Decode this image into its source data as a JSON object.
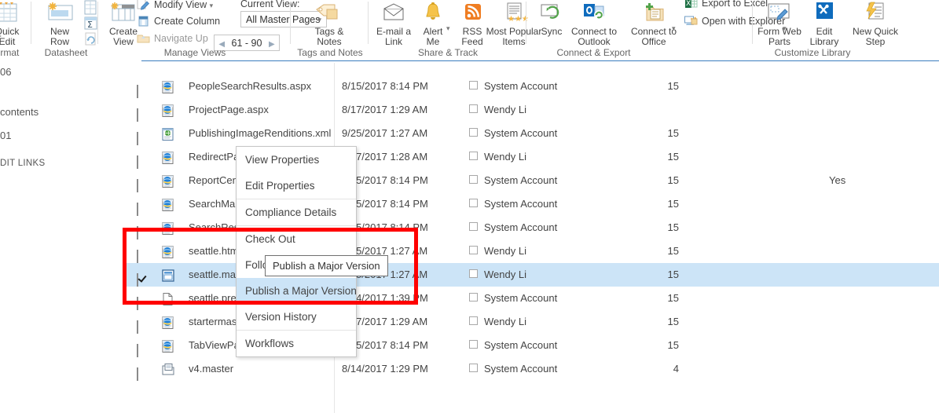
{
  "ribbon": {
    "groups": [
      {
        "name": "format",
        "label": "ormat"
      },
      {
        "name": "datasheet",
        "label": "Datasheet"
      },
      {
        "name": "manage-views",
        "label": "Manage Views"
      },
      {
        "name": "tags-and-notes",
        "label": "Tags and Notes"
      },
      {
        "name": "share-and-track",
        "label": "Share & Track"
      },
      {
        "name": "connect-and-export",
        "label": "Connect & Export"
      },
      {
        "name": "customize-library",
        "label": "Customize Library"
      }
    ],
    "buttons": {
      "quick_edit": "Quick\nEdit",
      "new_row": "New\nRow",
      "create_view": "Create\nView",
      "tags_notes": "Tags &\nNotes",
      "email_link": "E-mail a\nLink",
      "alert_me": "Alert\nMe",
      "rss_feed": "RSS\nFeed",
      "most_popular": "Most Popular\nItems",
      "sync": "Sync",
      "connect_outlook": "Connect to\nOutlook",
      "connect_office": "Connect to\nOffice",
      "form_web_parts": "Form Web\nParts",
      "edit_library": "Edit\nLibrary",
      "new_quick_step": "New Quick\nStep"
    },
    "small_commands": {
      "modify_view": "Modify View",
      "create_column": "Create Column",
      "navigate_up": "Navigate Up",
      "export_to_excel": "Export to Excel",
      "open_with_explorer": "Open with Explorer"
    },
    "current_view_label": "Current View:",
    "view_selector_value": "All Master Pages",
    "pager_value": "61 - 90"
  },
  "leftnav": {
    "fragments": [
      {
        "name": "nav-fragment-06",
        "text": "06"
      },
      {
        "name": "nav-fragment-contents",
        "text": "contents"
      },
      {
        "name": "nav-fragment-01",
        "text": "01"
      },
      {
        "name": "nav-fragment-edit-links",
        "text": "DIT LINKS"
      }
    ]
  },
  "list": {
    "rows": [
      {
        "name": "PeopleSearchResults.aspx",
        "icon": "aspx-page-icon",
        "date": "8/15/2017 8:14 PM",
        "modified_by": "System Account",
        "version": "15",
        "approved": "",
        "selected": false,
        "checked": false
      },
      {
        "name": "ProjectPage.aspx",
        "icon": "aspx-page-icon",
        "date": "8/17/2017 1:29 AM",
        "modified_by": "Wendy Li",
        "version": "",
        "approved": "",
        "selected": false,
        "checked": false
      },
      {
        "name": "PublishingImageRenditions.xml",
        "icon": "xml-file-icon",
        "date": "9/25/2017 1:27 AM",
        "modified_by": "System Account",
        "version": "15",
        "approved": "",
        "selected": false,
        "checked": false
      },
      {
        "name": "RedirectPageLayout.aspx",
        "icon": "aspx-page-icon",
        "date": "8/17/2017 1:28 AM",
        "modified_by": "Wendy Li",
        "version": "15",
        "approved": "",
        "selected": false,
        "checked": false
      },
      {
        "name": "ReportCenterLayout.aspx",
        "icon": "aspx-page-icon",
        "date": "8/15/2017 8:14 PM",
        "modified_by": "System Account",
        "version": "15",
        "approved": "Yes",
        "selected": false,
        "checked": false
      },
      {
        "name": "SearchMain.aspx",
        "icon": "aspx-page-icon",
        "date": "8/15/2017 8:14 PM",
        "modified_by": "System Account",
        "version": "15",
        "approved": "",
        "selected": false,
        "checked": false
      },
      {
        "name": "SearchResults.aspx",
        "icon": "aspx-page-icon",
        "date": "8/15/2017 8:14 PM",
        "modified_by": "System Account",
        "version": "15",
        "approved": "",
        "selected": false,
        "checked": false
      },
      {
        "name": "seattle.html",
        "icon": "aspx-page-icon",
        "date": "9/25/2017 1:27 AM",
        "modified_by": "Wendy Li",
        "version": "15",
        "approved": "",
        "selected": false,
        "checked": false
      },
      {
        "name": "seattle.master",
        "icon": "master-page-icon",
        "date": "9/25/2017 1:27 AM",
        "modified_by": "Wendy Li",
        "version": "15",
        "approved": "",
        "selected": true,
        "checked": true
      },
      {
        "name": "seattle.preview",
        "icon": "blank-file-icon",
        "date": "8/14/2017 1:39 PM",
        "modified_by": "System Account",
        "version": "15",
        "approved": "",
        "selected": false,
        "checked": false
      },
      {
        "name": "startermaster.master",
        "icon": "aspx-page-icon",
        "date": "8/17/2017 1:29 AM",
        "modified_by": "Wendy Li",
        "version": "15",
        "approved": "",
        "selected": false,
        "checked": false
      },
      {
        "name": "TabViewPageLayout.aspx",
        "icon": "aspx-page-icon",
        "date": "8/15/2017 8:14 PM",
        "modified_by": "System Account",
        "version": "15",
        "approved": "",
        "selected": false,
        "checked": false
      },
      {
        "name": "v4.master",
        "icon": "master-file-icon",
        "date": "8/14/2017 1:29 PM",
        "modified_by": "System Account",
        "version": "4",
        "approved": "",
        "selected": false,
        "checked": false
      }
    ]
  },
  "context_menu": {
    "items": [
      {
        "label": "View Properties",
        "highlighted": false,
        "divider_after": false
      },
      {
        "label": "Edit Properties",
        "highlighted": false,
        "divider_after": true
      },
      {
        "label": "Compliance Details",
        "highlighted": false,
        "divider_after": true
      },
      {
        "label": "Check Out",
        "highlighted": false,
        "divider_after": false
      },
      {
        "label": "Follow",
        "highlighted": false,
        "divider_after": false
      },
      {
        "label": "Publish a Major Version",
        "highlighted": true,
        "divider_after": false
      },
      {
        "label": "Version History",
        "highlighted": false,
        "divider_after": true
      },
      {
        "label": "Workflows",
        "highlighted": false,
        "divider_after": false
      }
    ]
  },
  "tooltip": {
    "text": "Publish a Major Version"
  },
  "annotations": {
    "highlight_color": "#ff0000"
  },
  "colors": {
    "selection": "#cce4f7",
    "ribbon_accent": "#3b7dbf",
    "red": "#ff0000"
  }
}
